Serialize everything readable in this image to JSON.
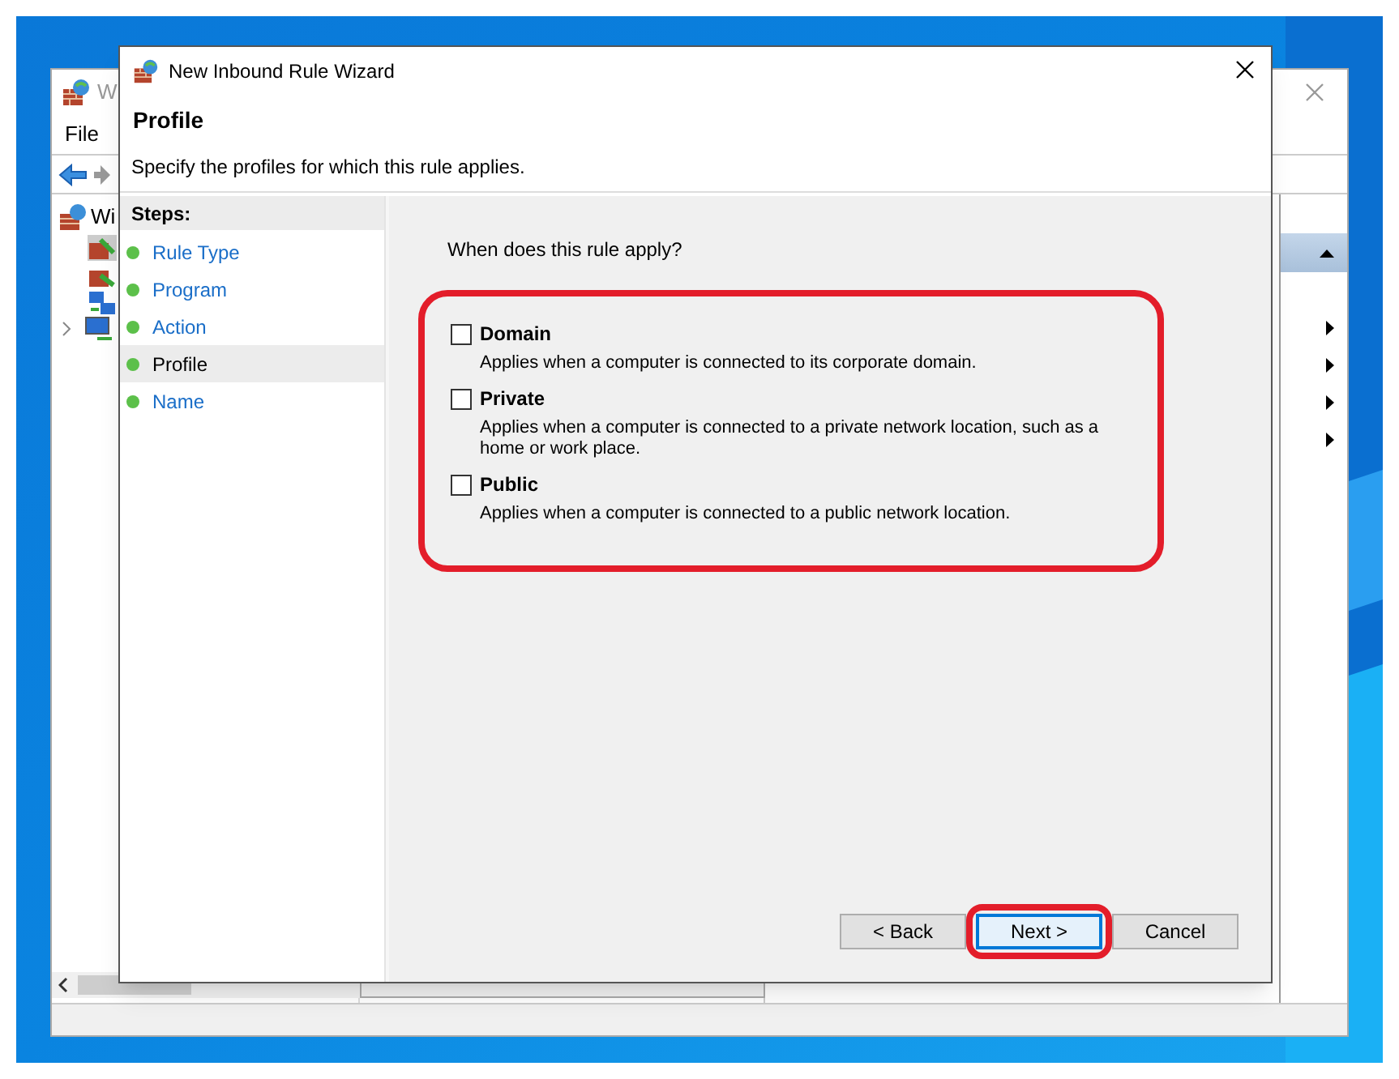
{
  "background_window": {
    "title": "W",
    "menu": [
      "File"
    ],
    "tree_root": "Wi"
  },
  "wizard": {
    "title": "New Inbound Rule Wizard",
    "heading": "Profile",
    "subheading": "Specify the profiles for which this rule applies.",
    "steps_title": "Steps:",
    "steps": [
      {
        "label": "Rule Type",
        "selected": false
      },
      {
        "label": "Program",
        "selected": false
      },
      {
        "label": "Action",
        "selected": false
      },
      {
        "label": "Profile",
        "selected": true
      },
      {
        "label": "Name",
        "selected": false
      }
    ],
    "question": "When does this rule apply?",
    "profiles_highlighted": true,
    "profiles": [
      {
        "name": "Domain",
        "checked": false,
        "description": "Applies when a computer is connected to its corporate domain."
      },
      {
        "name": "Private",
        "checked": false,
        "description": "Applies when a computer is connected to a private network location, such as a home or work place."
      },
      {
        "name": "Public",
        "checked": false,
        "description": "Applies when a computer is connected to a public network location."
      }
    ],
    "buttons": [
      {
        "label": "< Back",
        "focused": false,
        "highlighted": false
      },
      {
        "label": "Next >",
        "focused": true,
        "highlighted": true
      },
      {
        "label": "Cancel",
        "focused": false,
        "highlighted": false
      }
    ]
  }
}
